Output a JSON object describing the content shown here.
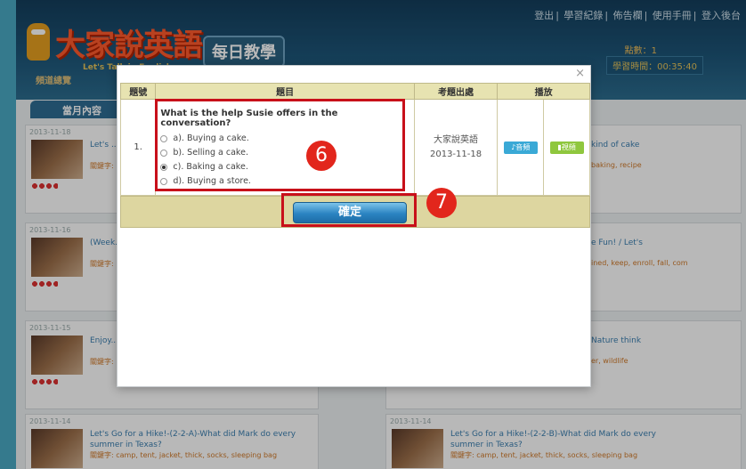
{
  "header": {
    "top_nav": [
      "登出",
      "學習紀錄",
      "佈告欄",
      "使用手冊",
      "登入後台"
    ],
    "logo_text": "大家說英語",
    "logo_sub": "Let's Talk in English",
    "daily_label": "每日教學",
    "points_label": "點數：1",
    "timer_label": "學習時間：00:35:40",
    "nav_item": "頻道總覽"
  },
  "month_tab": "當月內容",
  "background_cards": [
    {
      "date": "2013-11-18",
      "title": "Let's ... does ...",
      "keywords": "關鍵字: ...",
      "right_title": "kind of cake",
      "right_keywords": "baking, recipe"
    },
    {
      "date": "2013-11-16",
      "title": "(Week... Go fo...",
      "keywords": "關鍵字: ...",
      "right_title": "e Fun! / Let's",
      "right_keywords": "ined, keep, enroll, fall, com"
    },
    {
      "date": "2013-11-15",
      "title": "Enjoy... peopl...",
      "keywords": "關鍵字: ...",
      "right_title": "Nature think",
      "right_keywords": "er, wildlife"
    },
    {
      "date": "2013-11-14",
      "title": "Let's Go for a Hike!-(2-2-A)-What did Mark do every summer in Texas?",
      "keywords": "關鍵字: camp, tent, jacket, thick, socks, sleeping bag"
    },
    {
      "date": "2013-11-14",
      "title": "Let's Go for a Hike!-(2-2-B)-What did Mark do every summer in Texas?",
      "keywords": "關鍵字: camp, tent, jacket, thick, socks, sleeping bag"
    }
  ],
  "modal": {
    "close_symbol": "×",
    "columns": [
      "題號",
      "題目",
      "考題出處",
      "播放"
    ],
    "row": {
      "number": "1.",
      "question": "What is the help Susie offers in the conversation?",
      "options": [
        {
          "label": "a). Buying a cake.",
          "selected": false
        },
        {
          "label": "b). Selling a cake.",
          "selected": false
        },
        {
          "label": "c). Baking a cake.",
          "selected": true
        },
        {
          "label": "d). Buying a store.",
          "selected": false
        }
      ],
      "source_name": "大家說英語",
      "source_date": "2013-11-18",
      "audio_label": "音頻",
      "video_label": "視頻"
    },
    "confirm_label": "確定"
  },
  "annotations": {
    "badge_6": "6",
    "badge_7": "7",
    "highlight_color": "#c8101a"
  }
}
